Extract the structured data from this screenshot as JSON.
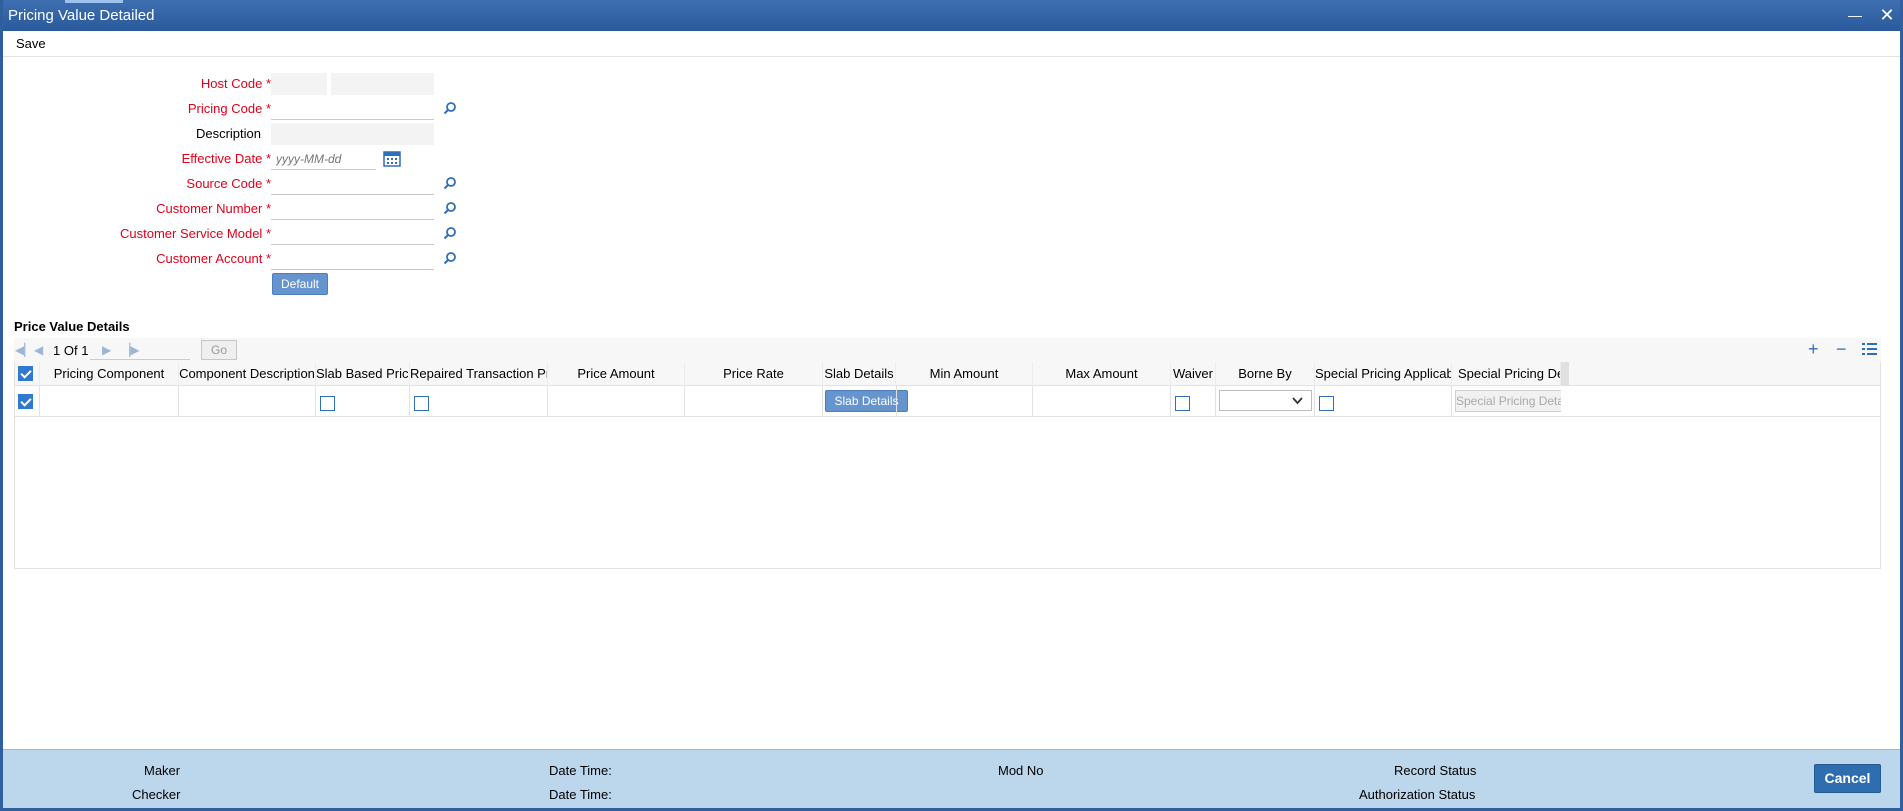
{
  "window": {
    "title": "Pricing Value Detailed"
  },
  "menu": {
    "save_label": "Save"
  },
  "form": {
    "host_code_label": "Host Code",
    "pricing_code_label": "Pricing Code",
    "description_label": "Description",
    "effective_date_label": "Effective Date",
    "effective_date_placeholder": "yyyy-MM-dd",
    "source_code_label": "Source Code",
    "customer_number_label": "Customer Number",
    "customer_service_model_label": "Customer Service Model",
    "customer_account_label": "Customer Account",
    "required_mark": "*",
    "default_button": "Default"
  },
  "grid": {
    "section_title": "Price Value Details",
    "page_current": "1",
    "page_of": "Of",
    "page_total": "1",
    "go_label": "Go",
    "columns": [
      "Pricing Component",
      "Component Description",
      "Slab Based Price",
      "Repaired Transaction Price",
      "Price Amount",
      "Price Rate",
      "Slab Details",
      "Min Amount",
      "Max Amount",
      "Waiver",
      "Borne By",
      "Special Pricing Applicable",
      "Special Pricing Details"
    ],
    "row_buttons": {
      "slab_details": "Slab Details",
      "special_pricing_details": "Special Pricing Details"
    }
  },
  "footer": {
    "maker": "Maker",
    "checker": "Checker",
    "date_time_1": "Date Time:",
    "date_time_2": "Date Time:",
    "mod_no": "Mod No",
    "record_status": "Record Status",
    "authorization_status": "Authorization Status",
    "cancel": "Cancel"
  },
  "colors": {
    "title_bar": "#2f5f9e",
    "required": "#e0001b",
    "footer": "#bcd6ec",
    "button": "#6594cf",
    "cancel": "#2f6eae"
  }
}
